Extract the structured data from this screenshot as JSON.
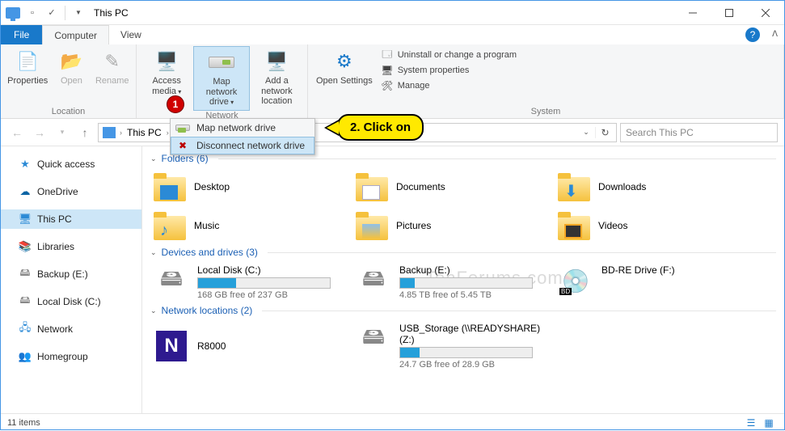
{
  "title": "This PC",
  "tabs": {
    "file": "File",
    "computer": "Computer",
    "view": "View"
  },
  "ribbon": {
    "location": {
      "label": "Location",
      "properties": "Properties",
      "open": "Open",
      "rename": "Rename"
    },
    "network": {
      "label": "Network",
      "access_media": "Access media",
      "map_drive": "Map network drive",
      "add_location": "Add a network location"
    },
    "system": {
      "label": "System",
      "open_settings": "Open Settings",
      "uninstall": "Uninstall or change a program",
      "sys_props": "System properties",
      "manage": "Manage"
    }
  },
  "dropdown": {
    "map": "Map network drive",
    "disconnect": "Disconnect network drive"
  },
  "callout": "2. Click on",
  "badge1": "1",
  "breadcrumb": {
    "root": "This PC"
  },
  "search_placeholder": "Search This PC",
  "sidebar": {
    "quick": "Quick access",
    "onedrive": "OneDrive",
    "thispc": "This PC",
    "libraries": "Libraries",
    "backup": "Backup (E:)",
    "localdisk": "Local Disk (C:)",
    "network": "Network",
    "homegroup": "Homegroup"
  },
  "sections": {
    "folders": "Folders (6)",
    "drives": "Devices and drives (3)",
    "netloc": "Network locations (2)"
  },
  "folders": [
    {
      "name": "Desktop"
    },
    {
      "name": "Documents"
    },
    {
      "name": "Downloads"
    },
    {
      "name": "Music"
    },
    {
      "name": "Pictures"
    },
    {
      "name": "Videos"
    }
  ],
  "drives": [
    {
      "name": "Local Disk (C:)",
      "free": "168 GB free of 237 GB",
      "pct": 29
    },
    {
      "name": "Backup (E:)",
      "free": "4.85 TB free of 5.45 TB",
      "pct": 11
    },
    {
      "name": "BD-RE Drive (F:)",
      "free": "",
      "pct": 0
    }
  ],
  "netlocs": [
    {
      "name": "R8000",
      "free": ""
    },
    {
      "name": "USB_Storage (\\\\READYSHARE) (Z:)",
      "free": "24.7 GB free of 28.9 GB",
      "pct": 15
    }
  ],
  "watermark": "TenForums.com",
  "status": {
    "items": "11 items"
  }
}
